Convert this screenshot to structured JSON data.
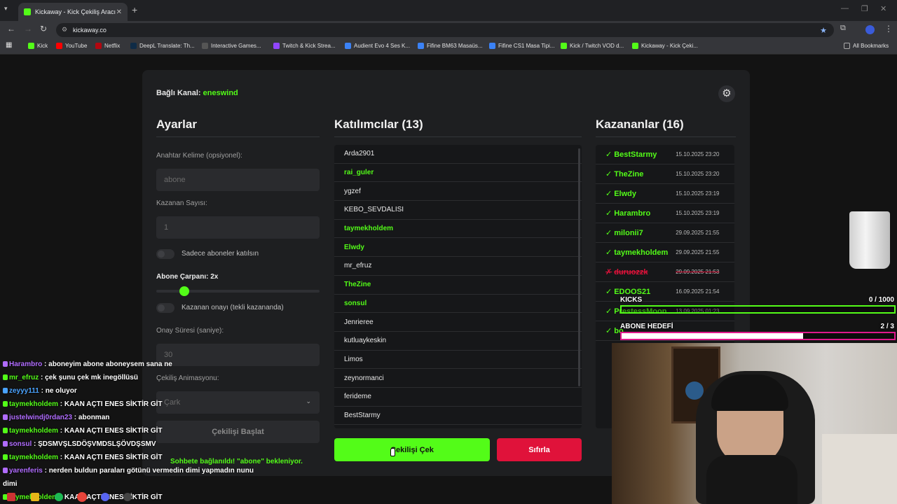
{
  "browser": {
    "tab_title": "Kickaway - Kick Çekiliş Aracı",
    "url": "kickaway.co",
    "bookmarks": [
      "Kick",
      "YouTube",
      "Netflix",
      "DeepL Translate: Th...",
      "Interactive Games...",
      "Twitch & Kick Strea...",
      "Audient Evo 4 Ses K...",
      "Fifine BM63 Masaüs...",
      "Fifine CS1 Masa Tipi...",
      "Kick / Twitch VOD d...",
      "Kickaway - Kick Çeki..."
    ],
    "all_bookmarks": "All Bookmarks"
  },
  "app": {
    "channel_label": "Bağlı Kanal:",
    "channel_name": "eneswind",
    "settings": {
      "title": "Ayarlar",
      "keyword_label": "Anahtar Kelime (opsiyonel):",
      "keyword_placeholder": "abone",
      "winner_count_label": "Kazanan Sayısı:",
      "winner_count_value": "1",
      "subs_only_label": "Sadece aboneler katılsın",
      "multiplier_label": "Abone Çarpanı:",
      "multiplier_value": "2x",
      "multiplier_fraction": 0.14,
      "approval_label": "Kazanan onayı (tekli kazananda)",
      "approval_time_label": "Onay Süresi (saniye):",
      "approval_time_value": "30",
      "animation_label": "Çekiliş Animasyonu:",
      "animation_value": "Çark",
      "start_button": "Çekilişi Başlat"
    },
    "participants": {
      "title": "Katılımcılar (13)",
      "items": [
        {
          "name": "Arda2901",
          "sub": false
        },
        {
          "name": "rai_guler",
          "sub": true
        },
        {
          "name": "ygzef",
          "sub": false
        },
        {
          "name": "KEBO_SEVDALISI",
          "sub": false
        },
        {
          "name": "taymekholdem",
          "sub": true
        },
        {
          "name": "Elwdy",
          "sub": true
        },
        {
          "name": "mr_efruz",
          "sub": false
        },
        {
          "name": "TheZine",
          "sub": true
        },
        {
          "name": "sonsul",
          "sub": true
        },
        {
          "name": "Jenrieree",
          "sub": false
        },
        {
          "name": "kutluaykeskin",
          "sub": false
        },
        {
          "name": "Limos",
          "sub": false
        },
        {
          "name": "zeynormanci",
          "sub": false
        },
        {
          "name": "ferideme",
          "sub": false
        },
        {
          "name": "BestStarmy",
          "sub": false
        }
      ]
    },
    "draw_button": "Çekilişi Çek",
    "reset_button": "Sıfırla",
    "status": "Sohbete bağlanıldı! \"abone\" bekleniyor.",
    "winners": {
      "title": "Kazananlar (16)",
      "items": [
        {
          "mark": "✓",
          "name": "BestStarmy",
          "date": "15.10.2025 23:20",
          "rejected": false
        },
        {
          "mark": "✓",
          "name": "TheZine",
          "date": "15.10.2025 23:20",
          "rejected": false
        },
        {
          "mark": "✓",
          "name": "Elwdy",
          "date": "15.10.2025 23:19",
          "rejected": false
        },
        {
          "mark": "✓",
          "name": "Harambro",
          "date": "15.10.2025 23:19",
          "rejected": false
        },
        {
          "mark": "✓",
          "name": "milonii7",
          "date": "29.09.2025 21:55",
          "rejected": false
        },
        {
          "mark": "✓",
          "name": "taymekholdem",
          "date": "29.09.2025 21:55",
          "rejected": false
        },
        {
          "mark": "✗",
          "name": "duruozzk",
          "date": "29.09.2025 21:53",
          "rejected": true
        },
        {
          "mark": "✓",
          "name": "EDOOS21",
          "date": "16.09.2025 21:54",
          "rejected": false
        },
        {
          "mark": "✓",
          "name": "PrestessMoon",
          "date": "13.09.2025 01:23",
          "rejected": false
        },
        {
          "mark": "✓",
          "name": "bo",
          "date": "",
          "rejected": false
        }
      ]
    }
  },
  "overlay": {
    "kicks_label": "KICKS",
    "kicks_value": "0  / 1000",
    "kicks_fraction": 0,
    "sub_goal_label": "ABONE HEDEFİ",
    "sub_goal_value": "2  / 3",
    "sub_goal_fraction": 0.667,
    "chat": [
      {
        "user": "Harambro",
        "color": "#b06cff",
        "msg": "aboneyim abone aboneysem sana ne"
      },
      {
        "user": "mr_efruz",
        "color": "#53fc18",
        "msg": "çek şunu çek mk inegöllüsü"
      },
      {
        "user": "zeyyy111",
        "color": "#4aa3ff",
        "msg": "ne oluyor"
      },
      {
        "user": "taymekholdem",
        "color": "#53fc18",
        "msg": "KAAN AÇTI ENES SİKTİR GİT"
      },
      {
        "user": "justelwindj0rdan23",
        "color": "#b06cff",
        "msg": "abonman"
      },
      {
        "user": "taymekholdem",
        "color": "#53fc18",
        "msg": "KAAN AÇTI ENES SİKTİR GİT"
      },
      {
        "user": "sonsul",
        "color": "#b06cff",
        "msg": "ŞDSMVŞLSDÖŞVMDSLŞÖVDŞSMV"
      },
      {
        "user": "taymekholdem",
        "color": "#53fc18",
        "msg": "KAAN AÇTI ENES SİKTİR GİT"
      },
      {
        "user": "yarenferis",
        "color": "#b06cff",
        "msg": "nerden buldun paraları götünü vermedin dimi yapmadın nunu"
      },
      {
        "user": "",
        "color": "#ffffff",
        "msg": "dimi"
      },
      {
        "user": "taymekholdem",
        "color": "#53fc18",
        "msg": "KAAN AÇTI ENES SİKTİR GİT"
      }
    ]
  }
}
